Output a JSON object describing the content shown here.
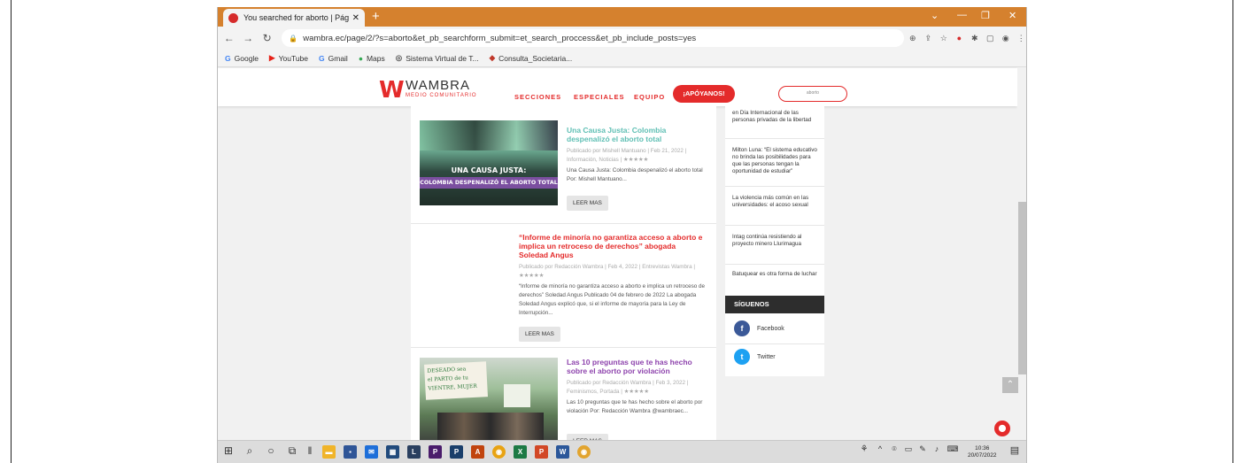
{
  "browser": {
    "tab_title": "You searched for aborto | Página",
    "tab_close": "✕",
    "new_tab": "+",
    "url": "wambra.ec/page/2/?s=aborto&et_pb_searchform_submit=et_search_proccess&et_pb_include_posts=yes",
    "bookmarks": [
      {
        "label": "Google",
        "glyph": "G",
        "color": "#4285f4"
      },
      {
        "label": "YouTube",
        "glyph": "▶",
        "color": "#e62117"
      },
      {
        "label": "Gmail",
        "glyph": "G",
        "color": "#4285f4"
      },
      {
        "label": "Maps",
        "glyph": "●",
        "color": "#34a853"
      },
      {
        "label": "Sistema Virtual de T...",
        "glyph": "◎",
        "color": "#555555"
      },
      {
        "label": "Consulta_Societaria...",
        "glyph": "◆",
        "color": "#c0392b"
      }
    ]
  },
  "site": {
    "logo_mark": "W",
    "logo_name": "WAMBRA",
    "logo_sub": "MEDIO COMUNITARIO",
    "menu": [
      "SECCIONES",
      "ESPECIALES",
      "EQUIPO"
    ],
    "donate": "¡APÓYANOS!",
    "search_value": "aborto",
    "accent": "#e42b2b"
  },
  "posts": [
    {
      "image_caption_1": "UNA CAUSA JUSTA:",
      "image_caption_2": "COLOMBIA DESPENALIZÓ EL ABORTO TOTAL",
      "title": "Una Causa Justa: Colombia despenalizó el aborto total",
      "title_color": "#5fbfb4",
      "meta": "Publicado por Mishell Mantuano | Feb 21, 2022 | Información, Noticias | ★★★★★",
      "excerpt": "  Una Causa Justa: Colombia despenalizó el aborto total   Por: Mishell Mantuano...",
      "readmore": "LEER MAS"
    },
    {
      "title": "“Informe de minoría no garantiza acceso a aborto e implica un retroceso de derechos” abogada Soledad Angus",
      "title_color": "#e42b2b",
      "meta": "Publicado por Redacción Wambra | Feb 4, 2022 | Entrevistas Wambra | ★★★★★",
      "excerpt": "“Informe de minoría no garantiza acceso a aborto e implica un retroceso de derechos” Soledad Angus   Publicado 04 de febrero de 2022 La abogada Soledad Angus explicó que, si el informe de mayoría para la Ley de Interrupción...",
      "readmore": "LEER MAS"
    },
    {
      "image_caption_1": "DESEADO sea",
      "image_caption_2": "el PARTO de tu VIENTRE, MUJER",
      "title": "Las 10 preguntas que te has hecho sobre el aborto por violación",
      "title_color": "#8e44ad",
      "meta": "Publicado por Redacción Wambra | Feb 3, 2022 | Feminismos, Portada | ★★★★★",
      "excerpt": "Las 10 preguntas que te has hecho sobre el aborto por violación   Por: Redacción Wambra @wambraec...",
      "readmore": "LEER MAS"
    }
  ],
  "sidebar": {
    "recent": [
      "en Día Internacional de las personas privadas de la libertad",
      "Milton Luna: “El sistema educativo no brinda las posibilidades para que las personas tengan la oportunidad de estudiar”",
      "La violencia más común en las universidades: el acoso sexual",
      "Intag continúa resistiendo al proyecto minero Llurimagua",
      "Batuquear es otra forma de luchar"
    ],
    "follow_heading": "SÍGUENOS",
    "social": [
      {
        "label": "Facebook",
        "glyph": "f",
        "color": "#3b5998"
      },
      {
        "label": "Twitter",
        "glyph": "t",
        "color": "#1da1f2"
      }
    ]
  },
  "taskbar": {
    "time": "10:36",
    "date": "20/07/2022"
  }
}
